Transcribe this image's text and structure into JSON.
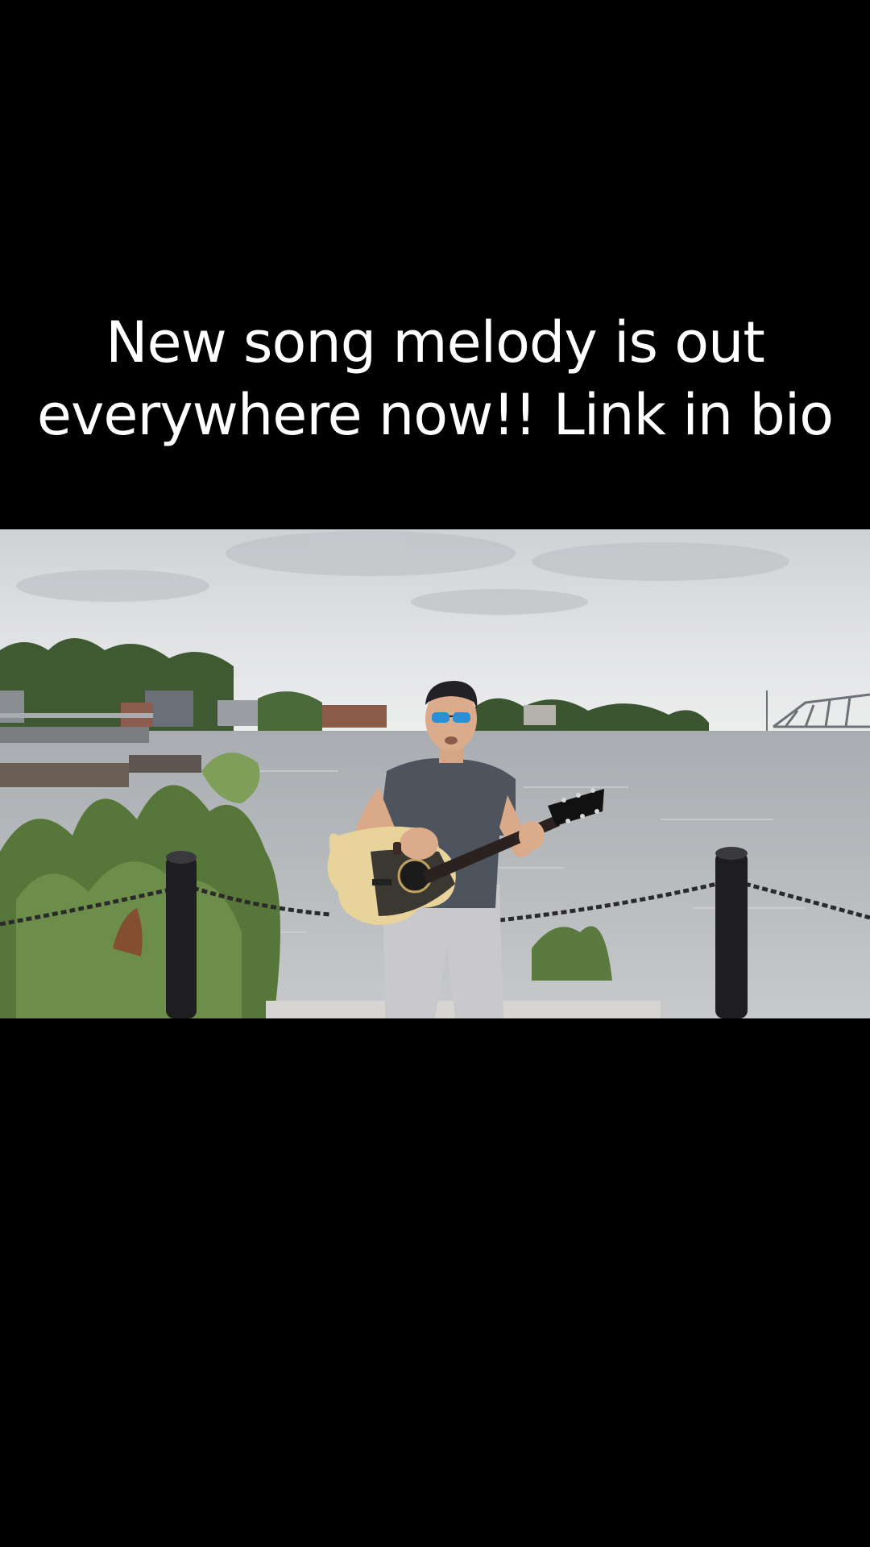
{
  "caption": {
    "text": "New song melody is out everywhere now!! Link in bio"
  },
  "video": {
    "icon": "video-frame",
    "scene": {
      "sky_color": "#d8dadc",
      "water_color": "#b9bcbf",
      "foliage_color": "#3e5a2c",
      "shirt_color": "#4d545e",
      "pants_color": "#c9c9cd",
      "guitar_color": "#e8d39a"
    }
  },
  "colors": {
    "background": "#000000",
    "caption_text": "#ffffff"
  }
}
